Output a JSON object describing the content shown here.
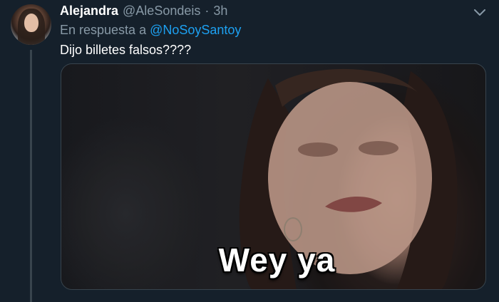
{
  "tweet": {
    "author": {
      "display_name": "Alejandra",
      "handle": "@AleSondeis",
      "separator": "·",
      "time": "3h"
    },
    "reply": {
      "prefix": "En respuesta a",
      "mention": "@NoSoySantoy"
    },
    "text": "Dijo billetes falsos????",
    "media": {
      "caption": "Wey ya"
    }
  },
  "icons": {
    "avatar": "profile-photo",
    "more": "chevron-down-icon"
  },
  "colors": {
    "background": "#15202b",
    "secondary_text": "#8899a6",
    "link": "#1da1f2",
    "border": "#38444d"
  }
}
